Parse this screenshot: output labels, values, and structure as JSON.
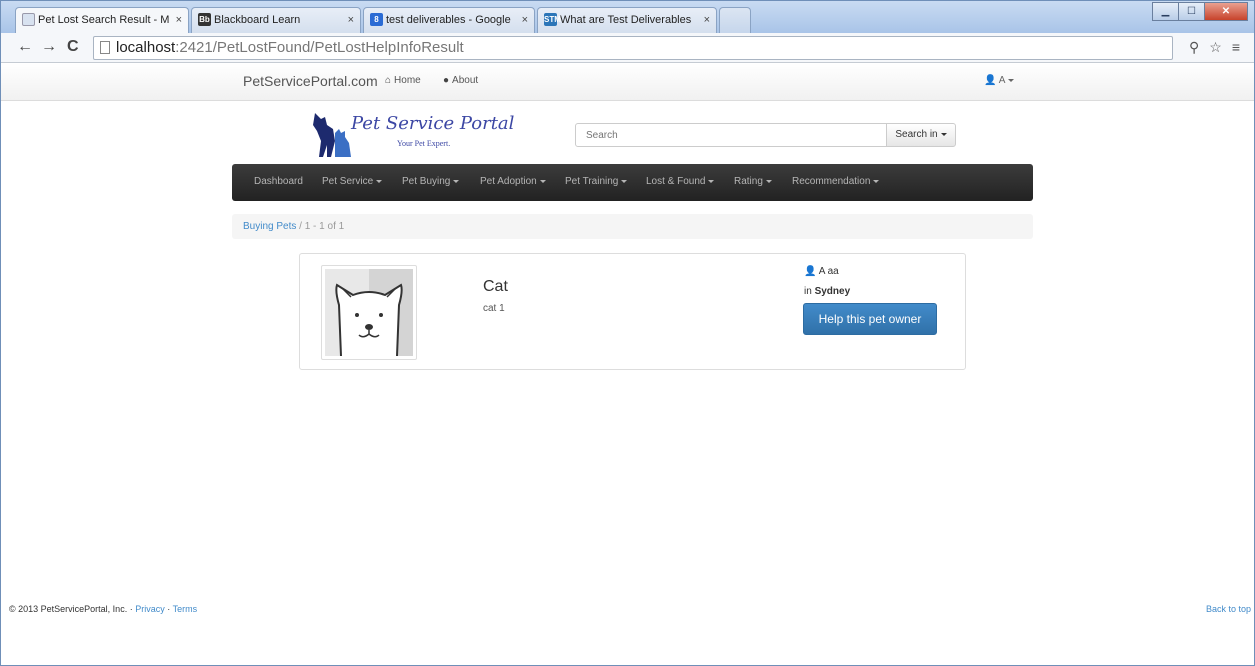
{
  "browser": {
    "tabs": [
      {
        "title": "Pet Lost Search Result - M",
        "active": true
      },
      {
        "title": "Blackboard Learn",
        "active": false
      },
      {
        "title": "test deliverables - Google",
        "active": false
      },
      {
        "title": "What are Test Deliverables",
        "active": false
      }
    ],
    "url_host": "localhost",
    "url_path": ":2421/PetLostFound/PetLostHelpInfoResult",
    "close_glyph": "×"
  },
  "topnav": {
    "brand": "PetServicePortal.com",
    "home": "Home",
    "about": "About",
    "user": "A"
  },
  "logo": {
    "title": "Pet Service Portal",
    "tagline": "Your Pet Expert."
  },
  "search": {
    "placeholder": "Search",
    "button_label": "Search in"
  },
  "main_nav": {
    "items": [
      "Dashboard",
      "Pet Service",
      "Pet Buying",
      "Pet Adoption",
      "Pet Training",
      "Lost & Found",
      "Rating",
      "Recommendation"
    ]
  },
  "breadcrumb": {
    "link": "Buying Pets",
    "separator": "/",
    "count": "1 - 1 of 1"
  },
  "result": {
    "name": "Cat",
    "description": "cat 1",
    "owner": "A aa",
    "location_prefix": "in",
    "location": "Sydney",
    "button_label": "Help this pet owner"
  },
  "footer": {
    "copyright": "© 2013 PetServicePortal, Inc.",
    "dot": "·",
    "privacy": "Privacy",
    "terms": "Terms",
    "back_to_top": "Back to top"
  },
  "colors": {
    "link": "#428bca",
    "primary_button": "#428bca",
    "nav_bg": "#222222",
    "logo": "#3c47a4"
  }
}
